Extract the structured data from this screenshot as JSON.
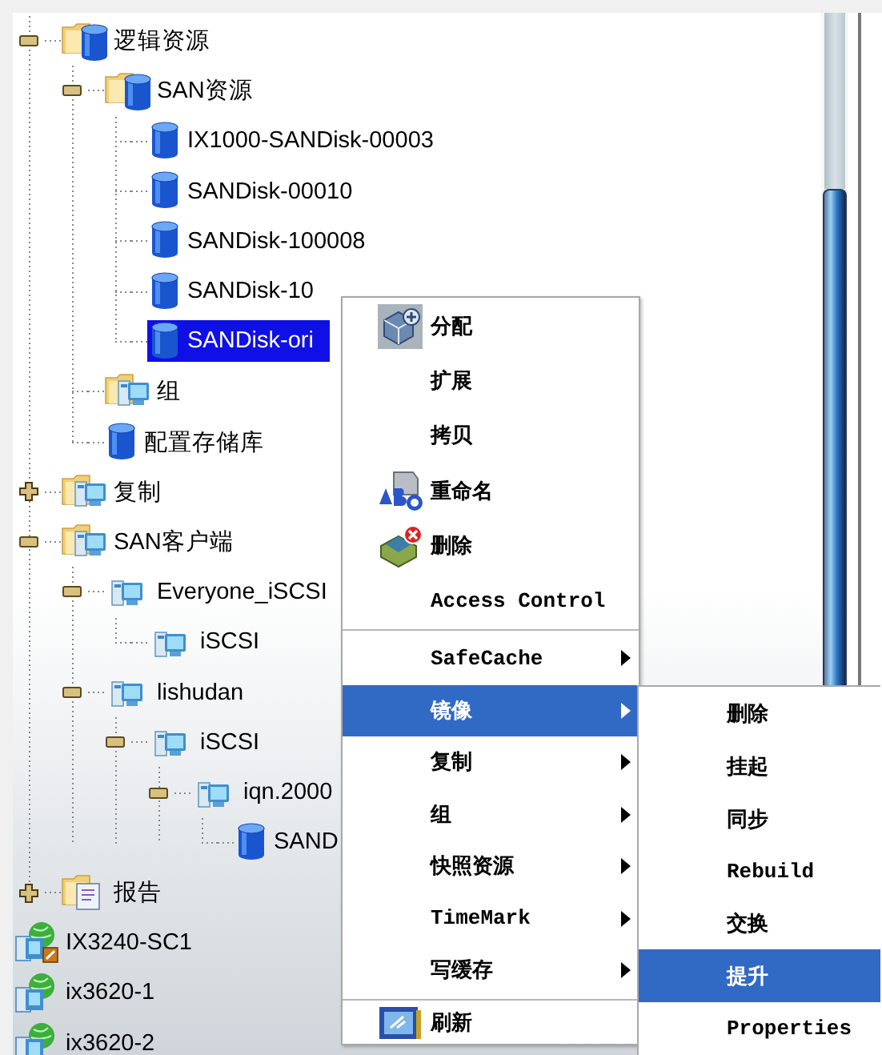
{
  "tree": [
    {
      "label": "逻辑资源",
      "kind": "folder-db",
      "expanded": true,
      "selected": false,
      "children": [
        {
          "label": "SAN资源",
          "kind": "folder-db",
          "expanded": true,
          "selected": false,
          "children": [
            {
              "label": "IX1000-SANDisk-00003",
              "kind": "disk",
              "selected": false
            },
            {
              "label": "SANDisk-00010",
              "kind": "disk",
              "selected": false
            },
            {
              "label": "SANDisk-100008",
              "kind": "disk",
              "selected": false
            },
            {
              "label": "SANDisk-10",
              "kind": "disk",
              "selected": false
            },
            {
              "label": "SANDisk-ori",
              "kind": "disk",
              "selected": true
            }
          ]
        },
        {
          "label": "组",
          "kind": "folder-client",
          "selected": false
        },
        {
          "label": "配置存储库",
          "kind": "disk",
          "selected": false
        }
      ]
    },
    {
      "label": "复制",
      "kind": "folder-client",
      "expanded": false,
      "selected": false
    },
    {
      "label": "SAN客户端",
      "kind": "folder-client",
      "expanded": true,
      "selected": false,
      "children": [
        {
          "label": "Everyone_iSCSI",
          "kind": "client",
          "expanded": true,
          "selected": false,
          "children": [
            {
              "label": "iSCSI",
              "kind": "client",
              "selected": false
            }
          ]
        },
        {
          "label": "lishudan",
          "kind": "client",
          "expanded": true,
          "selected": false,
          "children": [
            {
              "label": "iSCSI",
              "kind": "client",
              "expanded": true,
              "selected": false,
              "children": [
                {
                  "label": "iqn.2000",
                  "kind": "client",
                  "expanded": true,
                  "selected": false,
                  "children": [
                    {
                      "label": "SAND",
                      "kind": "disk",
                      "selected": false
                    }
                  ]
                }
              ]
            }
          ]
        }
      ]
    },
    {
      "label": "报告",
      "kind": "folder-report",
      "expanded": false,
      "selected": false
    }
  ],
  "servers": [
    {
      "label": "IX3240-SC1",
      "kind": "server-warning",
      "selected": false
    },
    {
      "label": "ix3620-1",
      "kind": "server",
      "selected": false
    },
    {
      "label": "ix3620-2",
      "kind": "server",
      "selected": false
    }
  ],
  "context_menu": {
    "items": [
      {
        "kind": "command",
        "label": "分配",
        "submenu": false,
        "selected": false
      },
      {
        "kind": "command",
        "label": "扩展",
        "submenu": false,
        "selected": false
      },
      {
        "kind": "command",
        "label": "拷贝",
        "submenu": false,
        "selected": false
      },
      {
        "kind": "command",
        "label": "重命名",
        "submenu": false,
        "selected": false
      },
      {
        "kind": "command",
        "label": "删除",
        "submenu": false,
        "selected": false
      },
      {
        "kind": "command",
        "label": "Access Control",
        "submenu": false,
        "selected": false
      },
      {
        "kind": "separator"
      },
      {
        "kind": "command",
        "label": "SafeCache",
        "submenu": true,
        "selected": false
      },
      {
        "kind": "command",
        "label": "镜像",
        "submenu": true,
        "selected": true
      },
      {
        "kind": "command",
        "label": "复制",
        "submenu": true,
        "selected": false
      },
      {
        "kind": "command",
        "label": "组",
        "submenu": true,
        "selected": false
      },
      {
        "kind": "command",
        "label": "快照资源",
        "submenu": true,
        "selected": false
      },
      {
        "kind": "command",
        "label": "TimeMark",
        "submenu": true,
        "selected": false
      },
      {
        "kind": "command",
        "label": "写缓存",
        "submenu": true,
        "selected": false
      },
      {
        "kind": "separator"
      },
      {
        "kind": "command",
        "label": "刷新",
        "submenu": false,
        "selected": false
      }
    ]
  },
  "submenu": {
    "items": [
      {
        "label": "删除",
        "selected": false
      },
      {
        "label": "挂起",
        "selected": false
      },
      {
        "label": "同步",
        "selected": false
      },
      {
        "label": "Rebuild",
        "selected": false
      },
      {
        "label": "交换",
        "selected": false
      },
      {
        "label": "提升",
        "selected": true
      },
      {
        "label": "Properties",
        "selected": false
      }
    ]
  }
}
